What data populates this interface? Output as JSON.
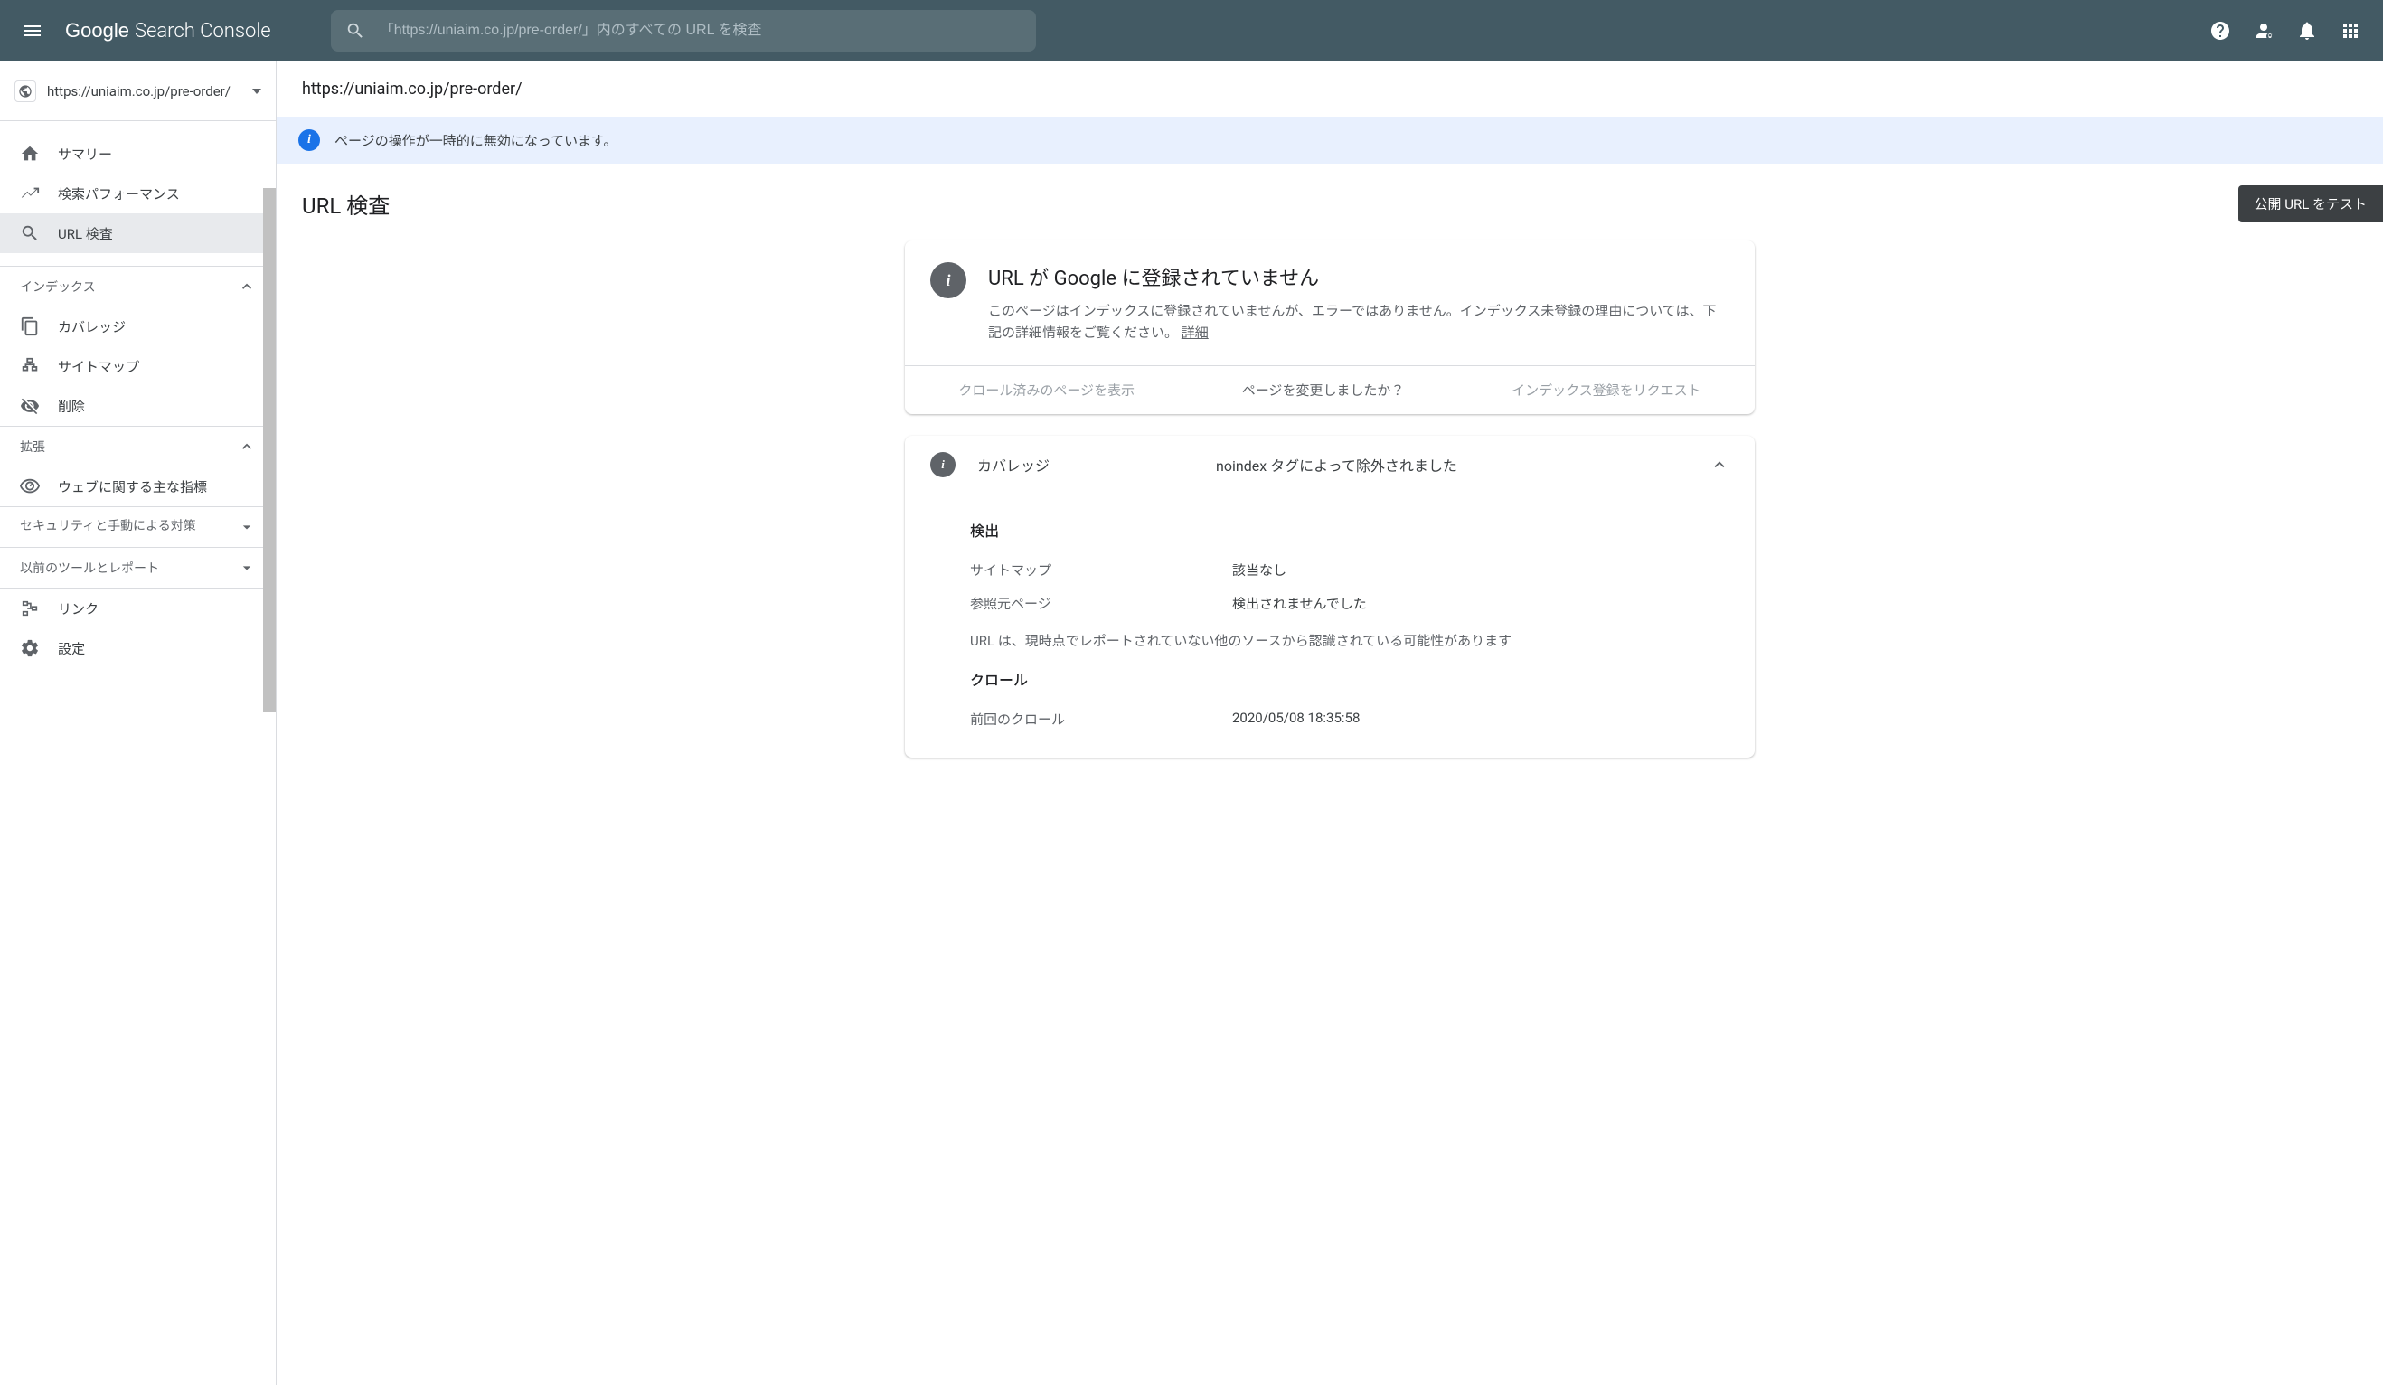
{
  "header": {
    "logo_google": "Google",
    "logo_sc": "Search Console",
    "search_placeholder": "「https://uniaim.co.jp/pre-order/」内のすべての URL を検査"
  },
  "sidebar": {
    "property_url": "https://uniaim.co.jp/pre-order/",
    "nav_top": [
      {
        "label": "サマリー"
      },
      {
        "label": "検索パフォーマンス"
      },
      {
        "label": "URL 検査"
      }
    ],
    "section_index": "インデックス",
    "nav_index": [
      {
        "label": "カバレッジ"
      },
      {
        "label": "サイトマップ"
      },
      {
        "label": "削除"
      }
    ],
    "section_enhance": "拡張",
    "nav_enhance": [
      {
        "label": "ウェブに関する主な指標"
      }
    ],
    "section_security": "セキュリティと手動による対策",
    "section_legacy": "以前のツールとレポート",
    "nav_bottom": [
      {
        "label": "リンク"
      },
      {
        "label": "設定"
      }
    ]
  },
  "main": {
    "url": "https://uniaim.co.jp/pre-order/",
    "banner": "ページの操作が一時的に無効になっています。",
    "title": "URL 検査",
    "test_btn": "公開 URL をテスト",
    "status": {
      "title": "URL が Google に登録されていません",
      "desc": "このページはインデックスに登録されていませんが、エラーではありません。インデックス未登録の理由については、下記の詳細情報をご覧ください。",
      "details_link": "詳細"
    },
    "actions": {
      "view_crawled": "クロール済みのページを表示",
      "changed": "ページを変更しましたか？",
      "request_index": "インデックス登録をリクエスト"
    },
    "coverage": {
      "label": "カバレッジ",
      "value": "noindex タグによって除外されました",
      "discovery_head": "検出",
      "sitemap_key": "サイトマップ",
      "sitemap_val": "該当なし",
      "referrer_key": "参照元ページ",
      "referrer_val": "検出されませんでした",
      "note": "URL は、現時点でレポートされていない他のソースから認識されている可能性があります",
      "crawl_head": "クロール",
      "last_crawl_key": "前回のクロール",
      "last_crawl_val": "2020/05/08 18:35:58"
    }
  }
}
